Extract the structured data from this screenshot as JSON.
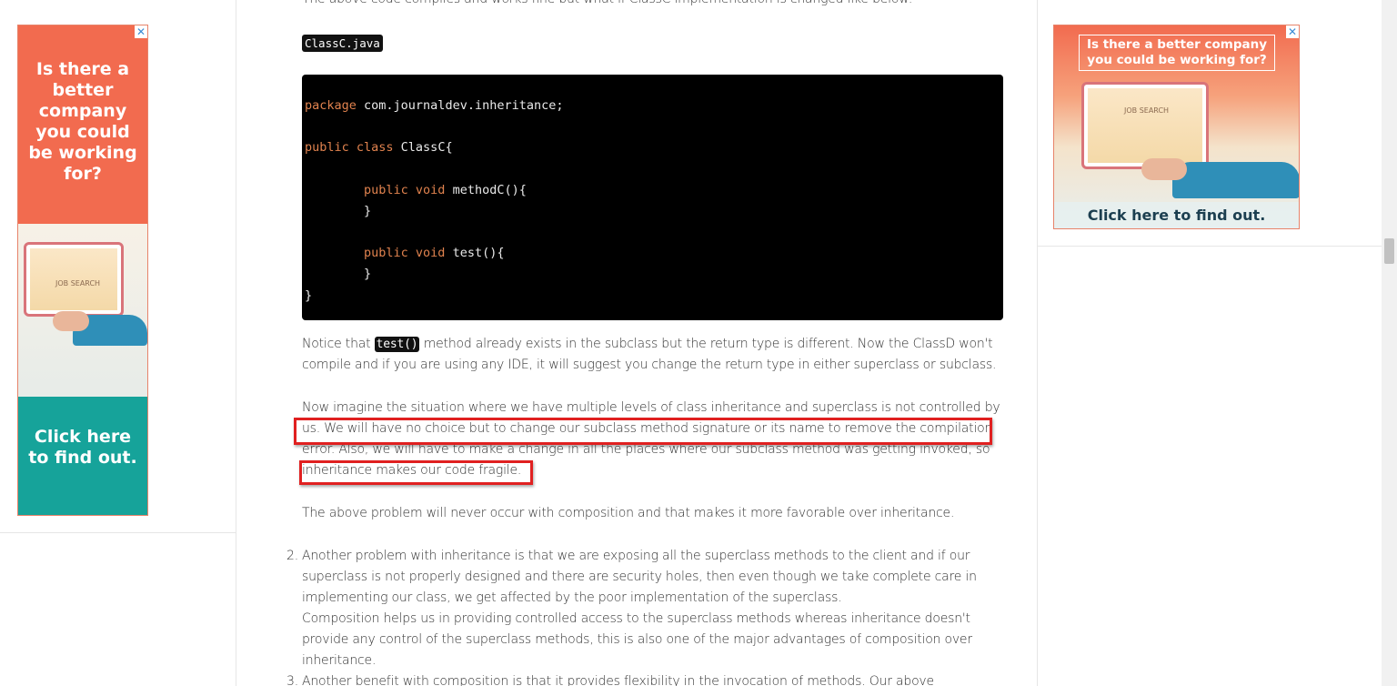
{
  "ads": {
    "left": {
      "headline": "Is there a better company you could be working for?",
      "screen_text": "JOB SEARCH",
      "cta": "Click here to find out.",
      "close": "✕"
    },
    "right": {
      "headline": "Is there a better company you could be working for?",
      "screen_text": "JOB SEARCH",
      "cta": "Click here to find out.",
      "close": "✕"
    }
  },
  "article": {
    "cut_top_text": "The above code compiles and works fine but what if ClassC implementation is changed like below:",
    "file_label": "ClassC.java",
    "code_lines": [
      {
        "kw": "package",
        "rest": " com.journaldev.inheritance;"
      },
      {
        "kw": "public class",
        "rest": " ClassC{"
      },
      {
        "kw": "        public void",
        "rest": " methodC(){"
      },
      {
        "kw": "",
        "rest": "        }"
      },
      {
        "kw": "        public void",
        "rest": " test(){"
      },
      {
        "kw": "",
        "rest": "        }"
      },
      {
        "kw": "",
        "rest": "}"
      }
    ],
    "p1_before": "Notice that ",
    "p1_code": "test()",
    "p1_after": " method already exists in the subclass but the return type is different. Now the ClassD won't compile and if you are using any IDE, it will suggest you change the return type in either superclass or subclass.",
    "p2": "Now imagine the situation where we have multiple levels of class inheritance and superclass is not controlled by us. We will have no choice but to change our subclass method signature or its name to remove the compilation error. Also, we will have to make a change in all the places where our subclass method was getting invoked, so inheritance makes our code fragile.",
    "p3": "The above problem will never occur with composition and that makes it more favorable over inheritance.",
    "list": [
      {
        "num": "2.",
        "text": "Another problem with inheritance is that we are exposing all the superclass methods to the client and if our superclass is not properly designed and there are security holes, then even though we take complete care in implementing our class, we get affected by the poor implementation of the superclass.",
        "text2": "Composition helps us in providing controlled access to the superclass methods whereas inheritance doesn't provide any control of the superclass methods, this is also one of the major advantages of composition over inheritance."
      },
      {
        "num": "3.",
        "text": "Another benefit with composition is that it provides flexibility in the invocation of methods. Our above"
      }
    ]
  },
  "colors": {
    "highlight_box": "#e02020",
    "code_keyword": "#e0824e",
    "code_bg": "#000000",
    "ad_orange": "#f26b4f",
    "ad_teal": "#16a39a"
  }
}
